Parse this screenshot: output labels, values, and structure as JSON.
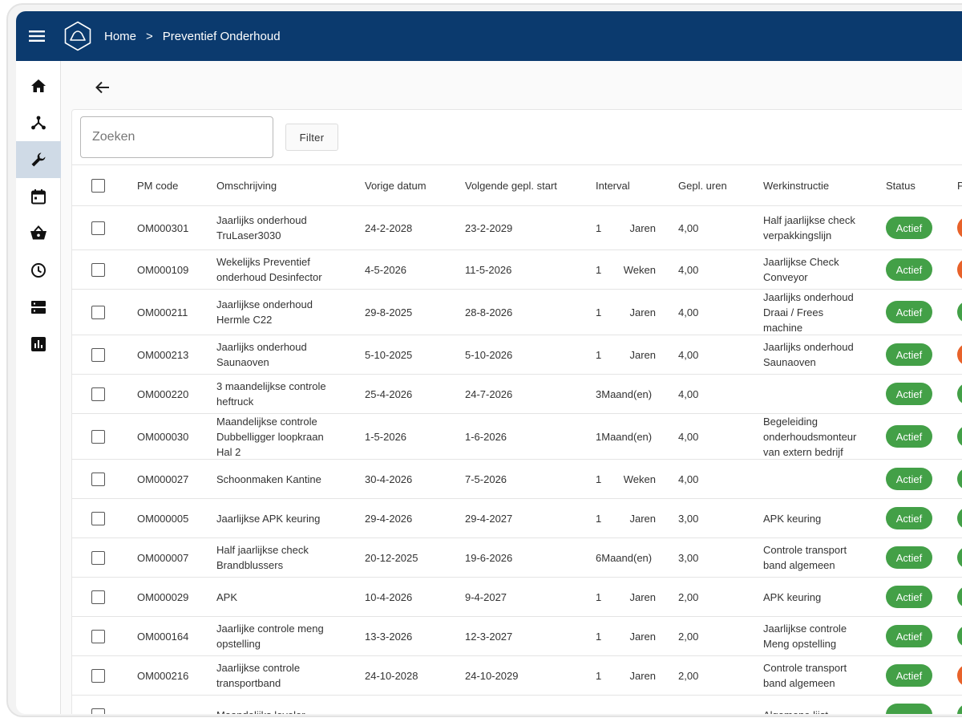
{
  "breadcrumb": {
    "home": "Home",
    "separator": ">",
    "current": "Preventief Onderhoud"
  },
  "search": {
    "placeholder": "Zoeken"
  },
  "filter_label": "Filter",
  "colors": {
    "topbar": "#0b3a6e",
    "active_status": "#43a047",
    "orange": "#e8622a",
    "sidebar_active": "#cfdae6"
  },
  "sidebar": [
    "home-icon",
    "network-icon",
    "wrench-icon",
    "calendar-icon",
    "basket-icon",
    "clock-icon",
    "server-icon",
    "chart-icon"
  ],
  "columns": {
    "code": "PM code",
    "desc": "Omschrijving",
    "prev": "Vorige datum",
    "next": "Volgende gepl. start",
    "interval": "Interval",
    "hours": "Gepl. uren",
    "wi": "Werkinstructie",
    "status": "Status",
    "p": "P"
  },
  "rows": [
    {
      "code": "OM000301",
      "desc": [
        "Jaarlijks onderhoud",
        "TruLaser3030"
      ],
      "prev": "24-2-2028",
      "next": "23-2-2029",
      "n": "1",
      "unit": "Jaren",
      "hours": "4,00",
      "wi": [
        "Half jaarlijkse check",
        "verpakkingslijn"
      ],
      "status": "Actief",
      "p": "orange"
    },
    {
      "code": "OM000109",
      "desc": [
        "Wekelijks Preventief",
        "onderhoud Desinfector"
      ],
      "prev": "4-5-2026",
      "next": "11-5-2026",
      "n": "1",
      "unit": "Weken",
      "hours": "4,00",
      "wi": [
        "Jaarlijkse Check",
        "Conveyor"
      ],
      "status": "Actief",
      "p": "orange"
    },
    {
      "code": "OM000211",
      "desc": [
        "Jaarlijkse onderhoud",
        "Hermle C22"
      ],
      "prev": "29-8-2025",
      "next": "28-8-2026",
      "n": "1",
      "unit": "Jaren",
      "hours": "4,00",
      "wi": [
        "Jaarlijks onderhoud",
        "Draai / Frees",
        "machine"
      ],
      "status": "Actief",
      "p": "green"
    },
    {
      "code": "OM000213",
      "desc": [
        "Jaarlijks onderhoud",
        "Saunaoven"
      ],
      "prev": "5-10-2025",
      "next": "5-10-2026",
      "n": "1",
      "unit": "Jaren",
      "hours": "4,00",
      "wi": [
        "Jaarlijks onderhoud",
        "Saunaoven"
      ],
      "status": "Actief",
      "p": "orange"
    },
    {
      "code": "OM000220",
      "desc": [
        "3 maandelijkse controle",
        "heftruck"
      ],
      "prev": "25-4-2026",
      "next": "24-7-2026",
      "n": "3",
      "unit": "Maand(en)",
      "hours": "4,00",
      "wi": [],
      "status": "Actief",
      "p": "green"
    },
    {
      "code": "OM000030",
      "desc": [
        "Maandelijkse controle",
        "Dubbelligger loopkraan",
        "Hal 2"
      ],
      "prev": "1-5-2026",
      "next": "1-6-2026",
      "n": "1",
      "unit": "Maand(en)",
      "hours": "4,00",
      "wi": [
        "Begeleiding",
        "onderhoudsmonteur",
        "van extern bedrijf"
      ],
      "status": "Actief",
      "p": "green"
    },
    {
      "code": "OM000027",
      "desc": [
        "Schoonmaken Kantine"
      ],
      "prev": "30-4-2026",
      "next": "7-5-2026",
      "n": "1",
      "unit": "Weken",
      "hours": "4,00",
      "wi": [],
      "status": "Actief",
      "p": "green"
    },
    {
      "code": "OM000005",
      "desc": [
        "Jaarlijkse APK keuring"
      ],
      "prev": "29-4-2026",
      "next": "29-4-2027",
      "n": "1",
      "unit": "Jaren",
      "hours": "3,00",
      "wi": [
        "APK keuring"
      ],
      "status": "Actief",
      "p": "green"
    },
    {
      "code": "OM000007",
      "desc": [
        "Half jaarlijkse check",
        "Brandblussers"
      ],
      "prev": "20-12-2025",
      "next": "19-6-2026",
      "n": "6",
      "unit": "Maand(en)",
      "hours": "3,00",
      "wi": [
        "Controle transport",
        "band algemeen"
      ],
      "status": "Actief",
      "p": "green"
    },
    {
      "code": "OM000029",
      "desc": [
        "APK"
      ],
      "prev": "10-4-2026",
      "next": "9-4-2027",
      "n": "1",
      "unit": "Jaren",
      "hours": "2,00",
      "wi": [
        "APK keuring"
      ],
      "status": "Actief",
      "p": "green"
    },
    {
      "code": "OM000164",
      "desc": [
        "Jaarlijke controle meng",
        "opstelling"
      ],
      "prev": "13-3-2026",
      "next": "12-3-2027",
      "n": "1",
      "unit": "Jaren",
      "hours": "2,00",
      "wi": [
        "Jaarlijkse controle",
        "Meng opstelling"
      ],
      "status": "Actief",
      "p": "green"
    },
    {
      "code": "OM000216",
      "desc": [
        "Jaarlijkse controle",
        "transportband"
      ],
      "prev": "24-10-2028",
      "next": "24-10-2029",
      "n": "1",
      "unit": "Jaren",
      "hours": "2,00",
      "wi": [
        "Controle transport",
        "band algemeen"
      ],
      "status": "Actief",
      "p": "orange"
    },
    {
      "code": "",
      "desc": [
        "Maandelijks leveler"
      ],
      "prev": "",
      "next": "",
      "n": "",
      "unit": "",
      "hours": "",
      "wi": [
        "Algemene lijst"
      ],
      "status": "",
      "p": "green"
    }
  ]
}
